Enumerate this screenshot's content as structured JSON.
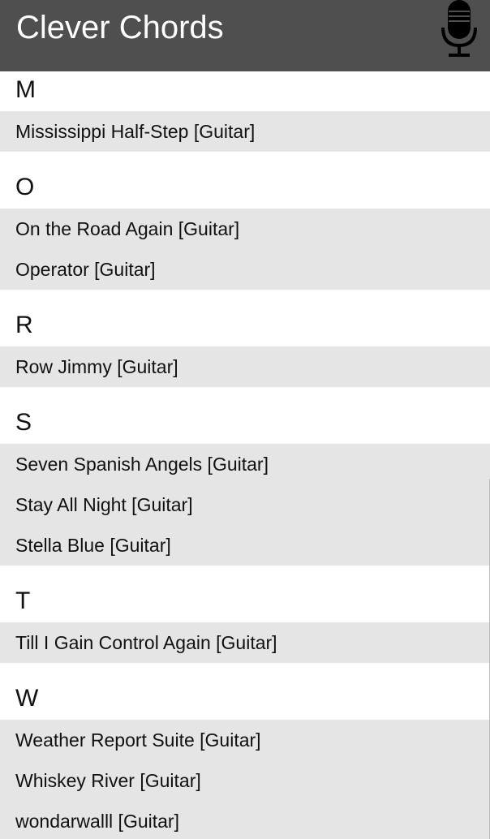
{
  "app": {
    "title": "Clever Chords",
    "mic_icon": "microphone-icon"
  },
  "sections": [
    {
      "letter": "M",
      "songs": [
        "Mississippi Half-Step [Guitar]"
      ]
    },
    {
      "letter": "O",
      "songs": [
        "On the Road Again [Guitar]",
        "Operator [Guitar]"
      ]
    },
    {
      "letter": "R",
      "songs": [
        "Row Jimmy [Guitar]"
      ]
    },
    {
      "letter": "S",
      "songs": [
        "Seven Spanish Angels [Guitar]",
        "Stay All Night [Guitar]",
        "Stella Blue [Guitar]"
      ]
    },
    {
      "letter": "T",
      "songs": [
        "Till I Gain Control Again [Guitar]"
      ]
    },
    {
      "letter": "W",
      "songs": [
        "Weather Report Suite [Guitar]",
        "Whiskey River [Guitar]",
        "wondarwalll [Guitar]"
      ]
    }
  ]
}
